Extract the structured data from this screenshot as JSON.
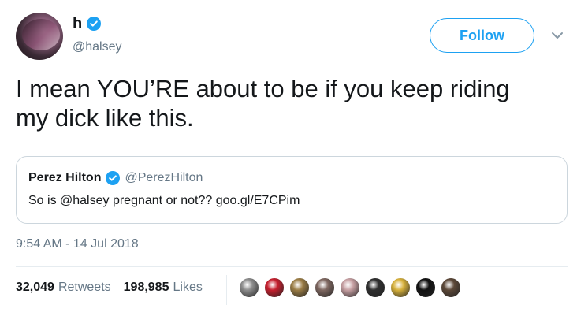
{
  "author": {
    "display_name": "h",
    "handle": "@halsey"
  },
  "actions": {
    "follow_label": "Follow"
  },
  "tweet": {
    "text": "I mean YOU’RE about to be if you keep riding my dick like this.",
    "timestamp": "9:54 AM - 14 Jul 2018"
  },
  "quoted_tweet": {
    "display_name": "Perez Hilton",
    "handle": "@PerezHilton",
    "text": "So is @halsey pregnant or not?? goo.gl/E7CPim"
  },
  "stats": {
    "retweets_count": "32,049",
    "retweets_label": "Retweets",
    "likes_count": "198,985",
    "likes_label": "Likes"
  },
  "colors": {
    "accent": "#1da1f2",
    "muted": "#657786",
    "border": "#ccd6dd"
  },
  "icons": {
    "verified": "verified-badge-icon",
    "menu": "chevron-down-icon"
  },
  "liker_avatars": [
    {
      "color": "#8d8d8d"
    },
    {
      "color": "#c51f2e"
    },
    {
      "color": "#9b7d45"
    },
    {
      "color": "#7e6760"
    },
    {
      "color": "#c7a0a3"
    },
    {
      "color": "#2f2f2f"
    },
    {
      "color": "#d7b13b"
    },
    {
      "color": "#111111"
    },
    {
      "color": "#5c4838"
    }
  ]
}
